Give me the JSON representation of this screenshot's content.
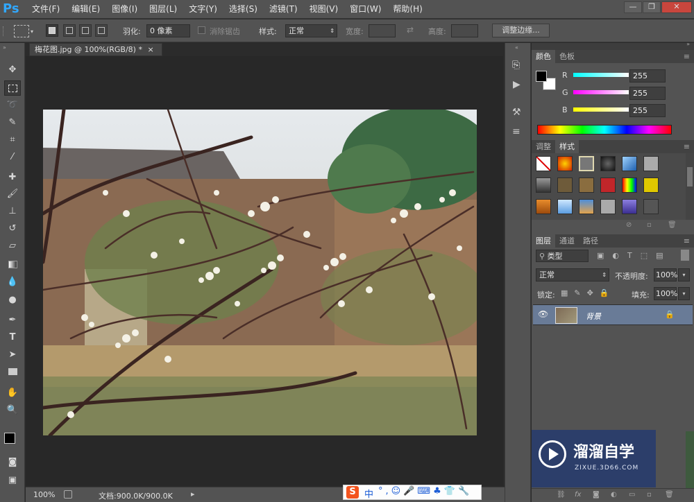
{
  "app": {
    "logo": "Ps"
  },
  "menu": [
    "文件(F)",
    "编辑(E)",
    "图像(I)",
    "图层(L)",
    "文字(Y)",
    "选择(S)",
    "滤镜(T)",
    "视图(V)",
    "窗口(W)",
    "帮助(H)"
  ],
  "window_controls": {
    "minimize": "—",
    "restore": "❐",
    "close": "✕"
  },
  "options": {
    "feather_label": "羽化:",
    "feather_value": "0 像素",
    "antialias_label": "消除锯齿",
    "style_label": "样式:",
    "style_value": "正常",
    "width_label": "宽度:",
    "height_label": "高度:",
    "refine_edge_button": "调整边缘..."
  },
  "document": {
    "tab_title": "梅花图.jpg @ 100%(RGB/8) *",
    "tab_close": "×",
    "zoom": "100%",
    "doc_info": "文档:900.0K/900.0K"
  },
  "panels": {
    "color_tabs": [
      "颜色",
      "色板"
    ],
    "color": {
      "r_label": "R",
      "g_label": "G",
      "b_label": "B",
      "r_value": "255",
      "g_value": "255",
      "b_value": "255"
    },
    "styles_tabs": [
      "调整",
      "样式"
    ],
    "layers_tabs": [
      "图层",
      "通道",
      "路径"
    ],
    "layers": {
      "filter_kind": "类型",
      "blend_mode": "正常",
      "opacity_label": "不透明度:",
      "opacity_value": "100%",
      "lock_label": "锁定:",
      "fill_label": "填充:",
      "fill_value": "100%",
      "layer_name": "背景"
    }
  },
  "watermark": {
    "title": "溜溜自学",
    "url": "ZIXUE.3D66.COM"
  },
  "ime": {
    "logo": "S",
    "label": "中"
  },
  "colors": {
    "accent": "#31a8ff",
    "panel": "#535353",
    "canvas_bg": "#282828",
    "watermark_bg": "#2c3e6a"
  }
}
